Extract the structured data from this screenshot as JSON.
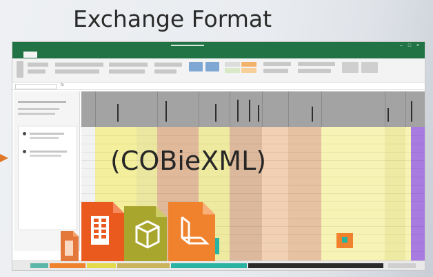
{
  "slide": {
    "title": "Exchange Format",
    "overlay": "(COBieXML)"
  },
  "colors": {
    "excel_green": "#217346",
    "yellow": "#f4ef9c",
    "tan": "#dfb99a",
    "purple": "#a77be0",
    "orange": "#f0822d",
    "olive": "#a9a62d",
    "teal": "#2ab3a3",
    "dark_tab": "#2b2b2b"
  },
  "icons": [
    "document-icon",
    "spreadsheet-icon",
    "box-model-icon",
    "chair-model-icon"
  ]
}
